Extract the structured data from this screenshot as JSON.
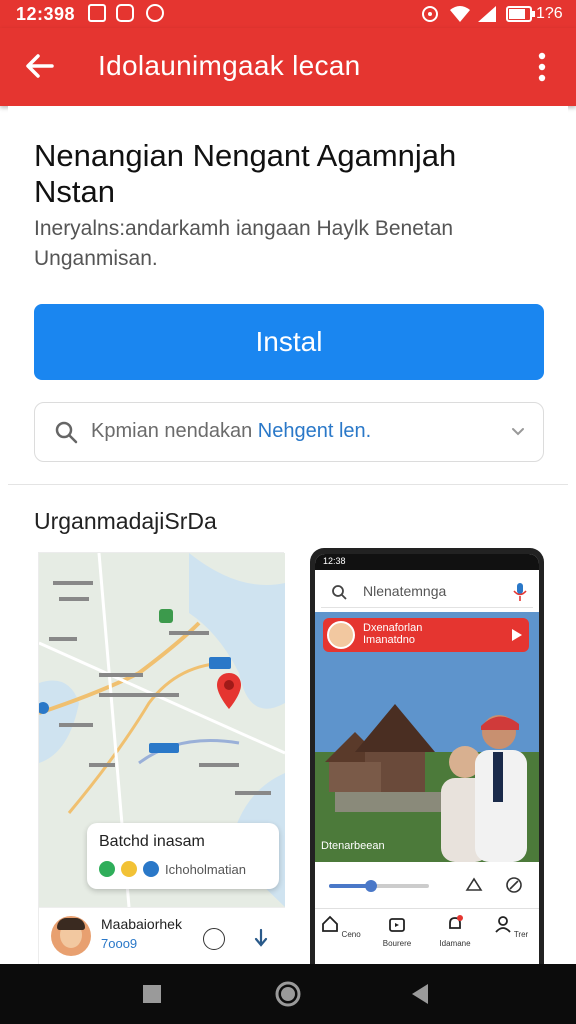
{
  "status_bar": {
    "time": "12:398",
    "battery_text": "1?6"
  },
  "app_bar": {
    "title": "Idolaunimgaak lecan",
    "back_icon": "arrow-left-icon",
    "more_icon": "more-vert-icon"
  },
  "main": {
    "heading": "Nenangian Nengant Agamnjah Nstan",
    "description": "Ineryalns:andarkamh iangaan Haylk Benetan Unganmisan.",
    "install_label": "Instal",
    "search": {
      "placeholder": "Kpmian nendakan",
      "placeholder_highlight": "Nehgent len.",
      "icon": "search-icon"
    },
    "section_title": "UrganmadajiSrDa"
  },
  "map_screenshot": {
    "info_title": "Batchd inasam",
    "info_row": "Ichoholmatian",
    "user_name": "Maabaiorhek",
    "user_sub": "7ooo9",
    "pin_color": "#e53530"
  },
  "phone_screenshot": {
    "status_time": "12:38",
    "search_text": "Nlenatemnga",
    "banner_line1": "Dxenaforlan",
    "banner_line2": "Imanatdno",
    "caption": "Dtenarbeean",
    "progress": 0.42,
    "nav_items": [
      "Ceno",
      "Bourere",
      "Idamane",
      "Trer"
    ]
  },
  "colors": {
    "brand_red": "#e53530",
    "install_blue": "#1a86f0"
  }
}
